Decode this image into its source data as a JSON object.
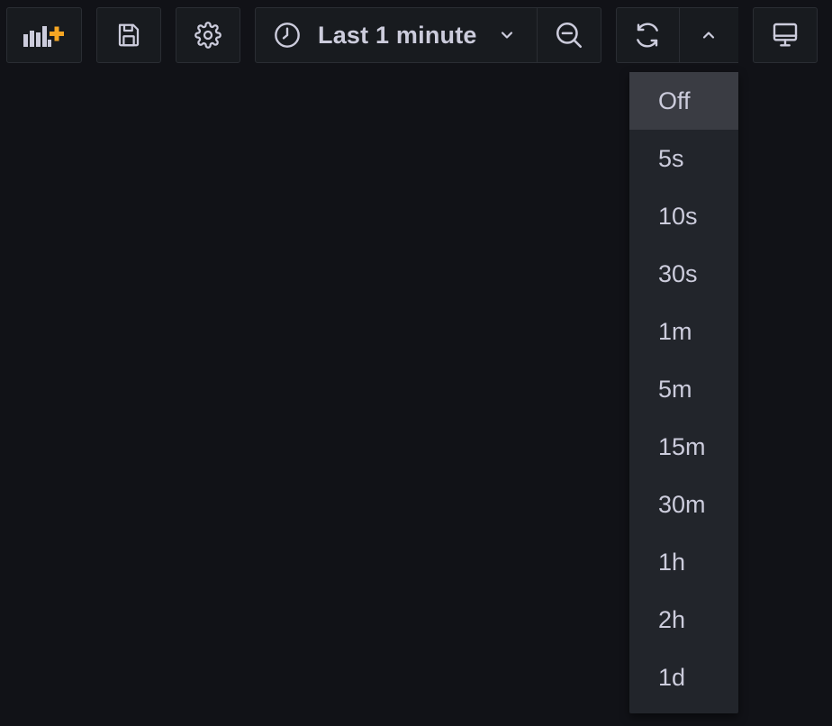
{
  "toolbar": {
    "add_panel_icon": "add-panel-icon",
    "save_icon": "save-icon",
    "settings_icon": "gear-icon",
    "time_picker": {
      "icon": "clock-icon",
      "label": "Last 1 minute",
      "caret_icon": "chevron-down-icon"
    },
    "zoom_out_icon": "zoom-out-icon",
    "refresh_icon": "refresh-icon",
    "interval_toggle_icon": "chevron-up-icon",
    "tv_mode_icon": "monitor-icon"
  },
  "refresh_intervals": {
    "selected": "Off",
    "options": [
      "Off",
      "5s",
      "10s",
      "30s",
      "1m",
      "5m",
      "15m",
      "30m",
      "1h",
      "2h",
      "1d"
    ]
  },
  "colors": {
    "background": "#111217",
    "button_bg": "#181b1f",
    "border": "#2a2d33",
    "text": "#ccccdc",
    "accent": "#f5a623",
    "dropdown_bg": "#22252b",
    "dropdown_selected": "#3a3c43"
  }
}
